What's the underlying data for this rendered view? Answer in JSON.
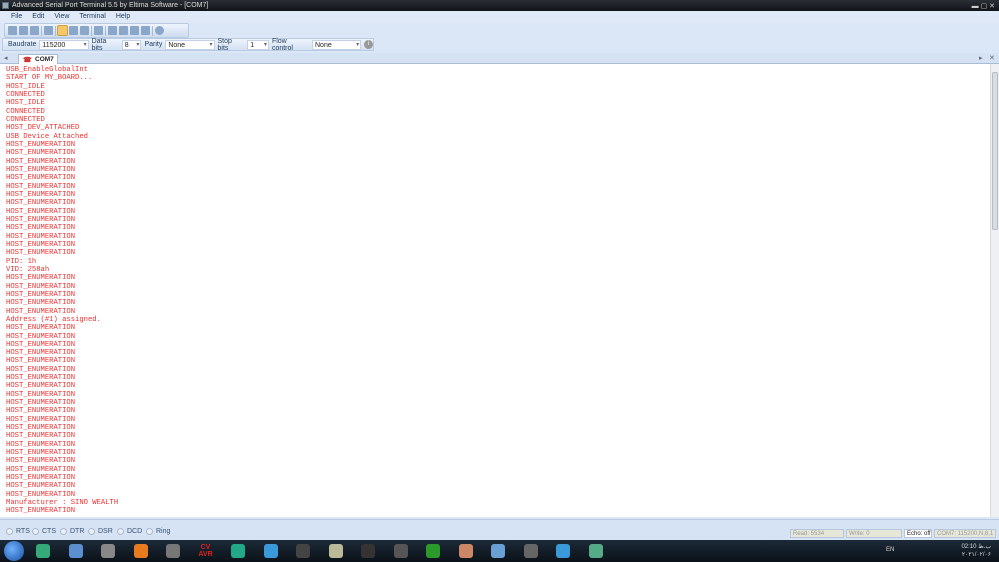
{
  "window": {
    "title": "Advanced Serial Port Terminal 5.5 by Eltima Software - [COM7]"
  },
  "menu": [
    "File",
    "Edit",
    "View",
    "Terminal",
    "Help"
  ],
  "settings": {
    "baudrate_label": "Baudrate",
    "baudrate": "115200",
    "databits_label": "Data bits",
    "databits": "8",
    "parity_label": "Parity",
    "parity": "None",
    "stopbits_label": "Stop bits",
    "stopbits": "1",
    "flow_label": "Flow control",
    "flow": "None"
  },
  "tab": {
    "label": "COM7"
  },
  "log": [
    "USB_EnableGlobalInt",
    "START OF MY_BOARD...",
    "HOST_IDLE",
    "CONNECTED",
    "HOST_IDLE",
    "CONNECTED",
    "CONNECTED",
    "HOST_DEV_ATTACHED",
    "USB Device Attached",
    "HOST_ENUMERATION",
    "HOST_ENUMERATION",
    "HOST_ENUMERATION",
    "HOST_ENUMERATION",
    "HOST_ENUMERATION",
    "HOST_ENUMERATION",
    "HOST_ENUMERATION",
    "HOST_ENUMERATION",
    "HOST_ENUMERATION",
    "HOST_ENUMERATION",
    "HOST_ENUMERATION",
    "HOST_ENUMERATION",
    "HOST_ENUMERATION",
    "HOST_ENUMERATION",
    "PID: 1h",
    "VID: 258ah",
    "HOST_ENUMERATION",
    "HOST_ENUMERATION",
    "HOST_ENUMERATION",
    "HOST_ENUMERATION",
    "HOST_ENUMERATION",
    "Address (#1) assigned.",
    "HOST_ENUMERATION",
    "HOST_ENUMERATION",
    "HOST_ENUMERATION",
    "HOST_ENUMERATION",
    "HOST_ENUMERATION",
    "HOST_ENUMERATION",
    "HOST_ENUMERATION",
    "HOST_ENUMERATION",
    "HOST_ENUMERATION",
    "HOST_ENUMERATION",
    "HOST_ENUMERATION",
    "HOST_ENUMERATION",
    "HOST_ENUMERATION",
    "HOST_ENUMERATION",
    "HOST_ENUMERATION",
    "HOST_ENUMERATION",
    "HOST_ENUMERATION",
    "HOST_ENUMERATION",
    "HOST_ENUMERATION",
    "HOST_ENUMERATION",
    "HOST_ENUMERATION",
    "Manufacturer : SINO WEALTH",
    "HOST_ENUMERATION"
  ],
  "signals": [
    "RTS",
    "CTS",
    "DTR",
    "DSR",
    "DCD",
    "Ring"
  ],
  "status": {
    "read": "Read: 5534",
    "write": "Write: 0",
    "echo": "Echo: off",
    "port": "COM7: 115200,N,8,1"
  },
  "taskbar": {
    "apps": [
      "chrome",
      "notepad",
      "box",
      "matlab",
      "x",
      "CV AVR",
      "ie",
      "MX",
      "eye",
      "oscilloscope",
      "terminal",
      "USB",
      "clover",
      "paint",
      "photo",
      "P",
      "MX",
      "monitor"
    ],
    "lang": "EN",
    "time": "02:10 ب.ظ",
    "date": "۲۰۲۱/۰۲/۰۶"
  },
  "colors": {
    "log_text": "#f03030"
  }
}
